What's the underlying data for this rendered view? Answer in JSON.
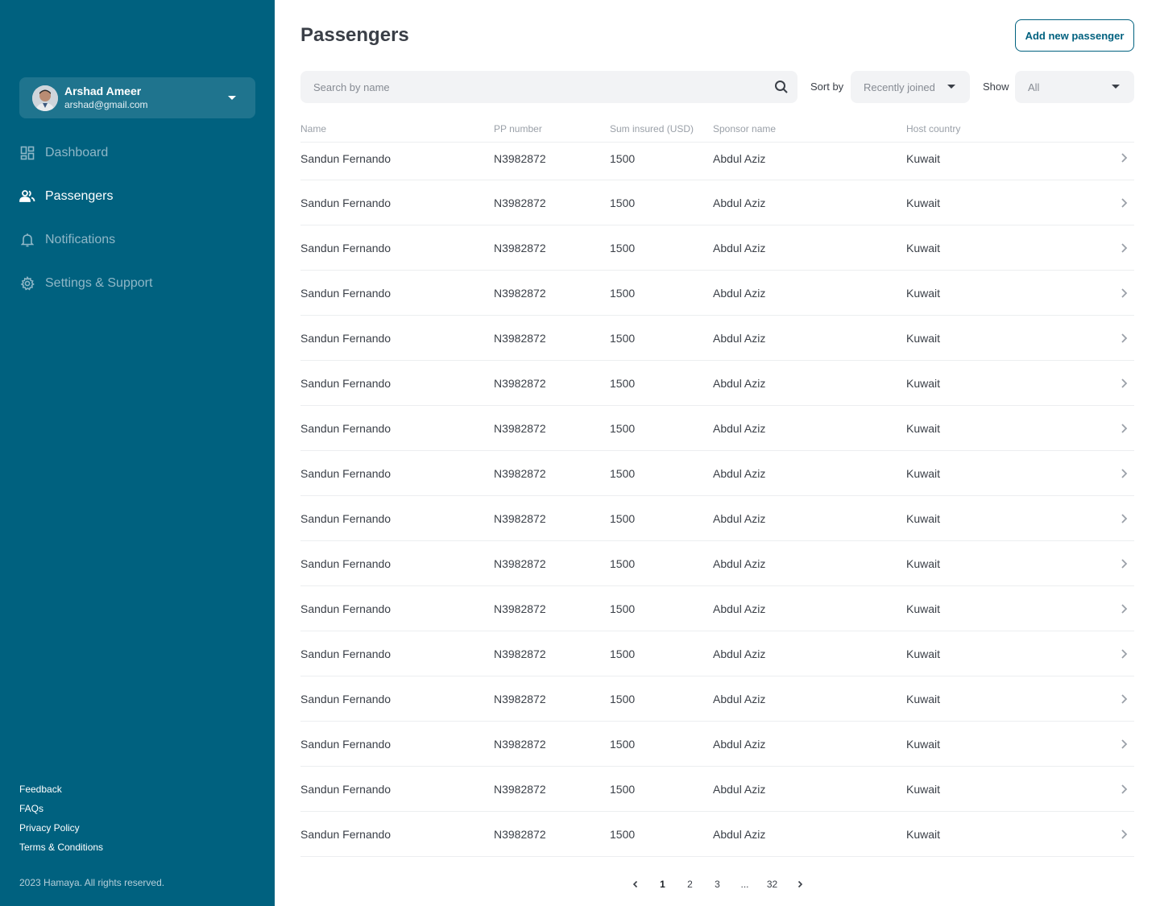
{
  "sidebar": {
    "profile": {
      "name": "Arshad Ameer",
      "email": "arshad@gmail.com"
    },
    "nav": [
      {
        "label": "Dashboard",
        "icon": "dashboard-icon",
        "active": false
      },
      {
        "label": "Passengers",
        "icon": "users-icon",
        "active": true
      },
      {
        "label": "Notifications",
        "icon": "bell-icon",
        "active": false
      },
      {
        "label": "Settings & Support",
        "icon": "gear-icon",
        "active": false
      }
    ],
    "footer_links": [
      "Feedback",
      "FAQs",
      "Privacy Policy",
      "Terms & Conditions"
    ],
    "copyright": "2023 Hamaya. All rights reserved."
  },
  "main": {
    "title": "Passengers",
    "add_button": "Add new passenger",
    "search": {
      "placeholder": "Search by name"
    },
    "sort": {
      "label": "Sort by",
      "value": "Recently joined"
    },
    "show": {
      "label": "Show",
      "value": "All"
    },
    "columns": [
      "Name",
      "PP number",
      "Sum insured (USD)",
      "Sponsor name",
      "Host country"
    ],
    "rows": [
      {
        "name": "Sandun Fernando",
        "pp": "N3982872",
        "sum": "1500",
        "sponsor": "Abdul Aziz",
        "country": "Kuwait"
      },
      {
        "name": "Sandun Fernando",
        "pp": "N3982872",
        "sum": "1500",
        "sponsor": "Abdul Aziz",
        "country": "Kuwait"
      },
      {
        "name": "Sandun Fernando",
        "pp": "N3982872",
        "sum": "1500",
        "sponsor": "Abdul Aziz",
        "country": "Kuwait"
      },
      {
        "name": "Sandun Fernando",
        "pp": "N3982872",
        "sum": "1500",
        "sponsor": "Abdul Aziz",
        "country": "Kuwait"
      },
      {
        "name": "Sandun Fernando",
        "pp": "N3982872",
        "sum": "1500",
        "sponsor": "Abdul Aziz",
        "country": "Kuwait"
      },
      {
        "name": "Sandun Fernando",
        "pp": "N3982872",
        "sum": "1500",
        "sponsor": "Abdul Aziz",
        "country": "Kuwait"
      },
      {
        "name": "Sandun Fernando",
        "pp": "N3982872",
        "sum": "1500",
        "sponsor": "Abdul Aziz",
        "country": "Kuwait"
      },
      {
        "name": "Sandun Fernando",
        "pp": "N3982872",
        "sum": "1500",
        "sponsor": "Abdul Aziz",
        "country": "Kuwait"
      },
      {
        "name": "Sandun Fernando",
        "pp": "N3982872",
        "sum": "1500",
        "sponsor": "Abdul Aziz",
        "country": "Kuwait"
      },
      {
        "name": "Sandun Fernando",
        "pp": "N3982872",
        "sum": "1500",
        "sponsor": "Abdul Aziz",
        "country": "Kuwait"
      },
      {
        "name": "Sandun Fernando",
        "pp": "N3982872",
        "sum": "1500",
        "sponsor": "Abdul Aziz",
        "country": "Kuwait"
      },
      {
        "name": "Sandun Fernando",
        "pp": "N3982872",
        "sum": "1500",
        "sponsor": "Abdul Aziz",
        "country": "Kuwait"
      },
      {
        "name": "Sandun Fernando",
        "pp": "N3982872",
        "sum": "1500",
        "sponsor": "Abdul Aziz",
        "country": "Kuwait"
      },
      {
        "name": "Sandun Fernando",
        "pp": "N3982872",
        "sum": "1500",
        "sponsor": "Abdul Aziz",
        "country": "Kuwait"
      },
      {
        "name": "Sandun Fernando",
        "pp": "N3982872",
        "sum": "1500",
        "sponsor": "Abdul Aziz",
        "country": "Kuwait"
      },
      {
        "name": "Sandun Fernando",
        "pp": "N3982872",
        "sum": "1500",
        "sponsor": "Abdul Aziz",
        "country": "Kuwait"
      }
    ],
    "pagination": {
      "pages": [
        "1",
        "2",
        "3",
        "...",
        "32"
      ],
      "current": "1"
    }
  },
  "colors": {
    "sidebar_bg": "#00617f",
    "accent": "#00617f",
    "text": "#3a3f47",
    "muted": "#9aa0a8"
  }
}
